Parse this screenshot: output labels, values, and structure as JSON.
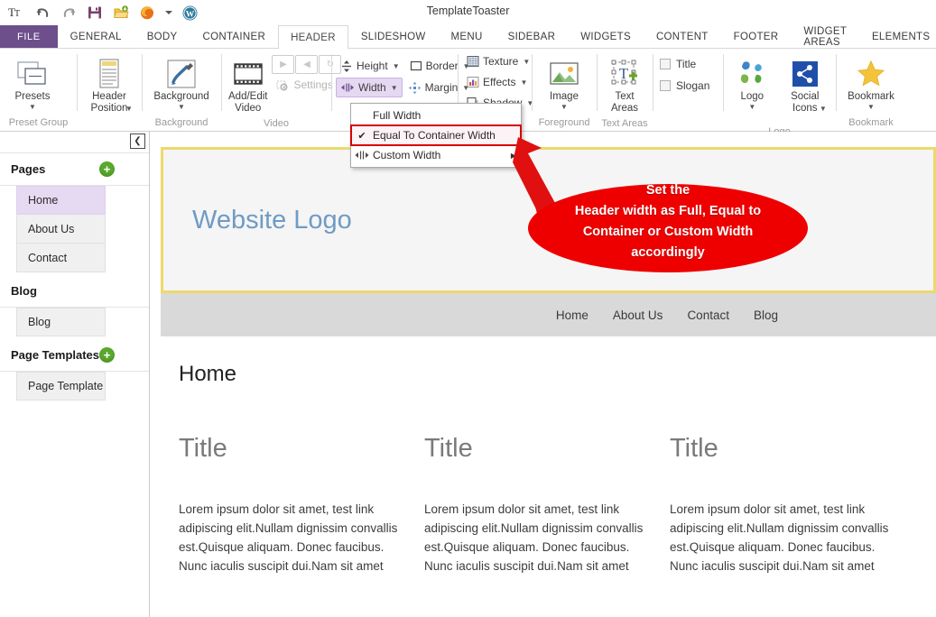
{
  "titlebar": {
    "app_title": "TemplateToaster",
    "quick_access": [
      {
        "name": "templatetoaster-logo-icon",
        "label": "TT"
      },
      {
        "name": "undo-icon",
        "label": "Undo"
      },
      {
        "name": "redo-icon",
        "label": "Redo"
      },
      {
        "name": "save-icon",
        "label": "Save"
      },
      {
        "name": "export-icon",
        "label": "Export"
      },
      {
        "name": "firefox-preview-icon",
        "label": "Preview in Firefox"
      },
      {
        "name": "preview-dropdown-icon",
        "label": "Preview options"
      },
      {
        "name": "wordpress-icon",
        "label": "WordPress"
      }
    ]
  },
  "tabs": [
    {
      "label": "FILE",
      "active": false,
      "file": true
    },
    {
      "label": "GENERAL",
      "active": false
    },
    {
      "label": "BODY",
      "active": false
    },
    {
      "label": "CONTAINER",
      "active": false
    },
    {
      "label": "HEADER",
      "active": true
    },
    {
      "label": "SLIDESHOW",
      "active": false
    },
    {
      "label": "MENU",
      "active": false
    },
    {
      "label": "SIDEBAR",
      "active": false
    },
    {
      "label": "WIDGETS",
      "active": false
    },
    {
      "label": "CONTENT",
      "active": false
    },
    {
      "label": "FOOTER",
      "active": false
    },
    {
      "label": "WIDGET AREAS",
      "active": false
    },
    {
      "label": "ELEMENTS",
      "active": false
    }
  ],
  "ribbon": {
    "groups": [
      {
        "label": "Preset Group",
        "buttons": [
          {
            "label": "Presets",
            "caret": "▼"
          }
        ]
      },
      {
        "label": "",
        "buttons": [
          {
            "label": "Header\nPosition",
            "caret": "▼"
          }
        ]
      },
      {
        "label": "Background",
        "buttons": [
          {
            "label": "Background",
            "caret": "▼"
          }
        ]
      },
      {
        "label": "Video",
        "buttons": [
          {
            "label": "Add/Edit\nVideo"
          },
          {
            "label": "Settings"
          }
        ]
      },
      {
        "label": "",
        "buttons": []
      },
      {
        "label": "Foreground",
        "buttons": [
          {
            "label": "Image",
            "caret": "▼"
          }
        ]
      },
      {
        "label": "Text Areas",
        "buttons": [
          {
            "label": "Text\nAreas"
          }
        ]
      },
      {
        "label": "",
        "buttons": []
      },
      {
        "label": "Logo",
        "buttons": [
          {
            "label": "Logo",
            "caret": "▼"
          },
          {
            "label": "Social\nIcons",
            "caret": "▼"
          }
        ]
      },
      {
        "label": "Bookmark",
        "buttons": [
          {
            "label": "Bookmark",
            "caret": "▼"
          }
        ]
      }
    ],
    "size_group": {
      "height_label": "Height",
      "border_label": "Border",
      "width_label": "Width",
      "margin_label": "Margin"
    },
    "style_group": {
      "texture_label": "Texture",
      "effects_label": "Effects",
      "shadow_label": "Shadow"
    },
    "video_group": {
      "add_edit_video_label": "Add/Edit\nVideo",
      "settings_label": "Settings"
    },
    "preset_label": "Presets",
    "header_position_label": "Header\nPosition",
    "background_label": "Background",
    "image_label": "Image",
    "text_areas_label": "Text\nAreas",
    "logo_label": "Logo",
    "social_icons_label": "Social\nIcons",
    "bookmark_label": "Bookmark",
    "title_checkbox_label": "Title",
    "slogan_checkbox_label": "Slogan",
    "group_labels": {
      "preset": "Preset Group",
      "background": "Background",
      "video": "Video",
      "foreground": "Foreground",
      "text_areas": "Text Areas",
      "logo": "Logo",
      "bookmark": "Bookmark"
    }
  },
  "width_menu": {
    "items": [
      {
        "label": "Full Width",
        "checked": false,
        "submenu": false,
        "highlighted": false
      },
      {
        "label": "Equal To Container Width",
        "checked": true,
        "submenu": false,
        "highlighted": true
      },
      {
        "label": "Custom Width",
        "checked": false,
        "submenu": true,
        "highlighted": false
      }
    ],
    "check_glyph": "✔",
    "arrow_glyph": "▶"
  },
  "sidebar": {
    "collapse_glyph": "❮",
    "sections": [
      {
        "title": "Pages",
        "has_add": true,
        "items": [
          {
            "label": "Home",
            "selected": true
          },
          {
            "label": "About Us",
            "selected": false
          },
          {
            "label": "Contact",
            "selected": false
          }
        ]
      },
      {
        "title": "Blog",
        "has_add": false,
        "items": [
          {
            "label": "Blog",
            "selected": false
          }
        ]
      },
      {
        "title": "Page Templates",
        "has_add": true,
        "items": [
          {
            "label": "Page Template",
            "selected": false
          }
        ]
      }
    ]
  },
  "preview": {
    "logo_text": "Website Logo",
    "nav": [
      "Home",
      "About Us",
      "Contact",
      "Blog"
    ],
    "page_title": "Home",
    "columns": [
      {
        "title": "Title",
        "body": "Lorem ipsum dolor sit amet, test link adipiscing elit.Nullam dignissim convallis est.Quisque aliquam. Donec faucibus. Nunc iaculis suscipit dui.Nam sit amet"
      },
      {
        "title": "Title",
        "body": "Lorem ipsum dolor sit amet, test link adipiscing elit.Nullam dignissim convallis est.Quisque aliquam. Donec faucibus. Nunc iaculis suscipit dui.Nam sit amet"
      },
      {
        "title": "Title",
        "body": "Lorem ipsum dolor sit amet, test link adipiscing elit.Nullam dignissim convallis est.Quisque aliquam. Donec faucibus. Nunc iaculis suscipit dui.Nam sit amet"
      }
    ]
  },
  "callout": {
    "line1": "Set the",
    "line2": "Header width as Full, Equal to",
    "line3": "Container or Custom Width",
    "line4": "accordingly",
    "color": "#ee0000"
  },
  "colors": {
    "file_tab": "#6d4f8c",
    "accent_purple": "#e4d8f2",
    "add_green": "#5aa82e",
    "header_border_yellow": "#ecd96b",
    "logo_blue": "#6f9bc4",
    "callout_red": "#ee0000",
    "highlight_red": "#d40000"
  }
}
